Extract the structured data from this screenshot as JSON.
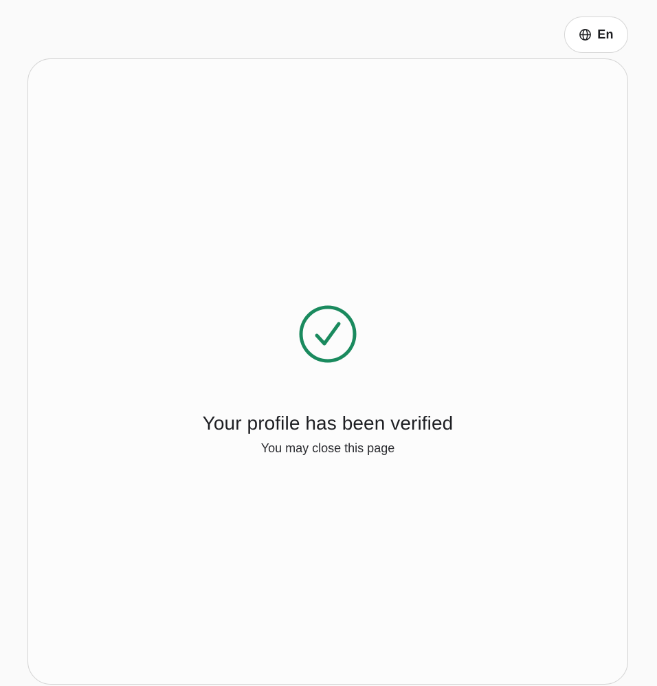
{
  "header": {
    "language_button": {
      "icon": "globe-icon",
      "label": "En"
    }
  },
  "status": {
    "icon": "check-circle-icon",
    "title": "Your profile has been verified",
    "subtitle": "You may close this page"
  },
  "colors": {
    "success": "#1a8a5e",
    "border": "#d3d3d3",
    "background": "#fafafa"
  }
}
